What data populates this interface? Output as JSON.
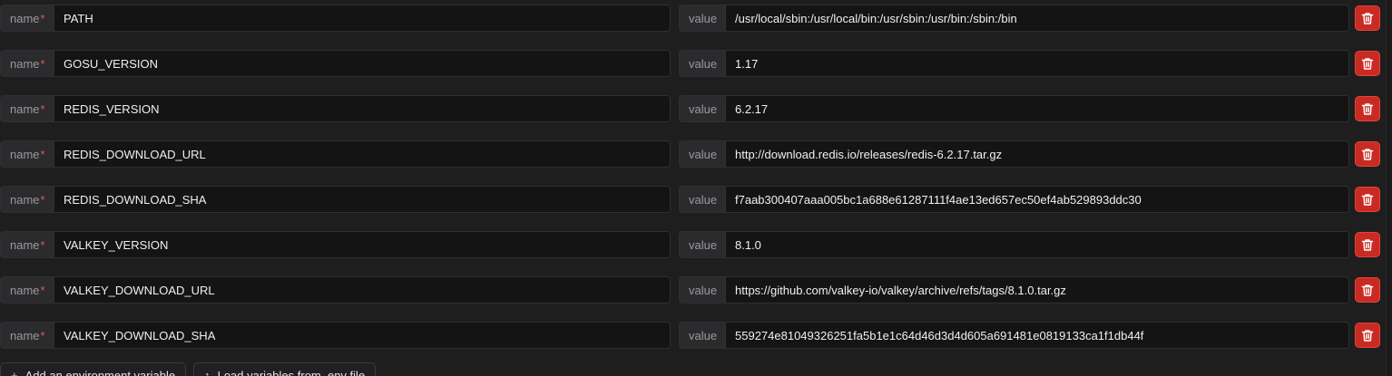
{
  "env_vars": {
    "name_label": "name",
    "required_mark": "*",
    "value_label": "value",
    "rows": [
      {
        "name": "PATH",
        "value": "/usr/local/sbin:/usr/local/bin:/usr/sbin:/usr/bin:/sbin:/bin"
      },
      {
        "name": "GOSU_VERSION",
        "value": "1.17"
      },
      {
        "name": "REDIS_VERSION",
        "value": "6.2.17"
      },
      {
        "name": "REDIS_DOWNLOAD_URL",
        "value": "http://download.redis.io/releases/redis-6.2.17.tar.gz"
      },
      {
        "name": "REDIS_DOWNLOAD_SHA",
        "value": "f7aab300407aaa005bc1a688e61287111f4ae13ed657ec50ef4ab529893ddc30"
      },
      {
        "name": "VALKEY_VERSION",
        "value": "8.1.0"
      },
      {
        "name": "VALKEY_DOWNLOAD_URL",
        "value": "https://github.com/valkey-io/valkey/archive/refs/tags/8.1.0.tar.gz"
      },
      {
        "name": "VALKEY_DOWNLOAD_SHA",
        "value": "559274e81049326251fa5b1e1c64d46d3d4d605a691481e0819133ca1f1db44f"
      }
    ],
    "delete_icon": "trash-icon"
  },
  "actions": {
    "add_label": "Add an environment variable",
    "add_icon": "plus-icon",
    "load_label": "Load variables from .env file",
    "load_icon": "upload-icon"
  },
  "colors": {
    "delete_button": "#c92a22",
    "required": "#e05a4f",
    "background": "#1e1e1f"
  }
}
